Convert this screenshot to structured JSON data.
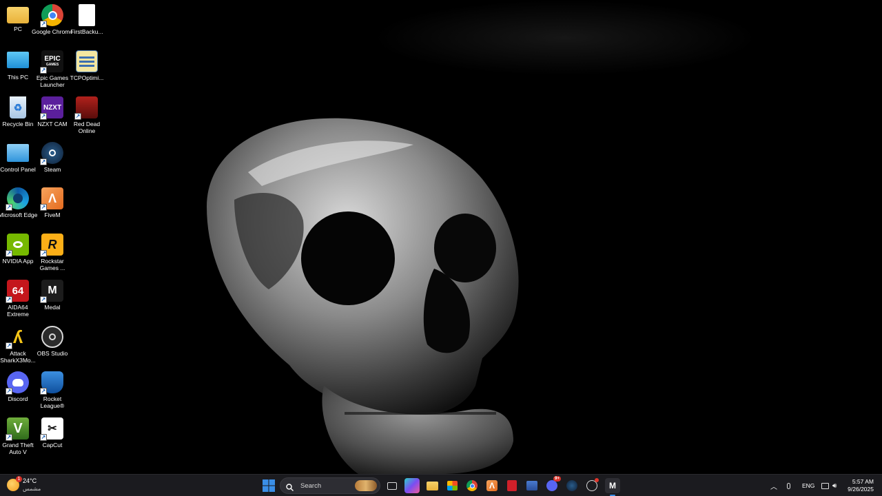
{
  "desktop": {
    "icons": [
      {
        "label": "PC",
        "icon": "folder-icon"
      },
      {
        "label": "Google Chrome",
        "icon": "chrome-icon"
      },
      {
        "label": "FirstBacku...",
        "icon": "document-icon"
      },
      {
        "label": "This PC",
        "icon": "monitor-icon"
      },
      {
        "label": "Epic Games Launcher",
        "icon": "epic-games-icon"
      },
      {
        "label": "TCPOptimi...",
        "icon": "tcp-optimizer-icon"
      },
      {
        "label": "Recycle Bin",
        "icon": "recycle-bin-icon"
      },
      {
        "label": "NZXT CAM",
        "icon": "nzxt-cam-icon"
      },
      {
        "label": "Red Dead Online",
        "icon": "red-dead-online-icon"
      },
      {
        "label": "Control Panel",
        "icon": "control-panel-icon"
      },
      {
        "label": "Steam",
        "icon": "steam-icon"
      },
      {
        "label": "Microsoft Edge",
        "icon": "edge-icon"
      },
      {
        "label": "FiveM",
        "icon": "fivem-icon"
      },
      {
        "label": "NVIDIA App",
        "icon": "nvidia-icon"
      },
      {
        "label": "Rockstar Games ...",
        "icon": "rockstar-icon"
      },
      {
        "label": "AIDA64 Extreme",
        "icon": "aida64-icon"
      },
      {
        "label": "Medal",
        "icon": "medal-icon"
      },
      {
        "label": "Attack SharkX3Mo...",
        "icon": "attack-shark-icon"
      },
      {
        "label": "OBS Studio",
        "icon": "obs-icon"
      },
      {
        "label": "Discord",
        "icon": "discord-icon"
      },
      {
        "label": "Rocket League®",
        "icon": "rocket-league-icon"
      },
      {
        "label": "Grand Theft Auto V",
        "icon": "gta-v-icon"
      },
      {
        "label": "CapCut",
        "icon": "capcut-icon"
      }
    ],
    "glyphs": {
      "epic": "EPIC",
      "epic_sub": "GAMES",
      "nzxt": "NZXT",
      "aida": "64",
      "rockstar": "R",
      "gta": "V"
    }
  },
  "taskbar": {
    "weather": {
      "temp": "24°C",
      "condition": "مشمس",
      "badge": "1"
    },
    "search": {
      "placeholder": "Search"
    },
    "discord_badge": "9+",
    "language": "ENG",
    "clock": {
      "time": "5:57 AM",
      "date": "9/26/2025"
    }
  },
  "colors": {
    "taskbar_bg": "#1b1b1f",
    "accent_blue": "#3a8ee6"
  }
}
